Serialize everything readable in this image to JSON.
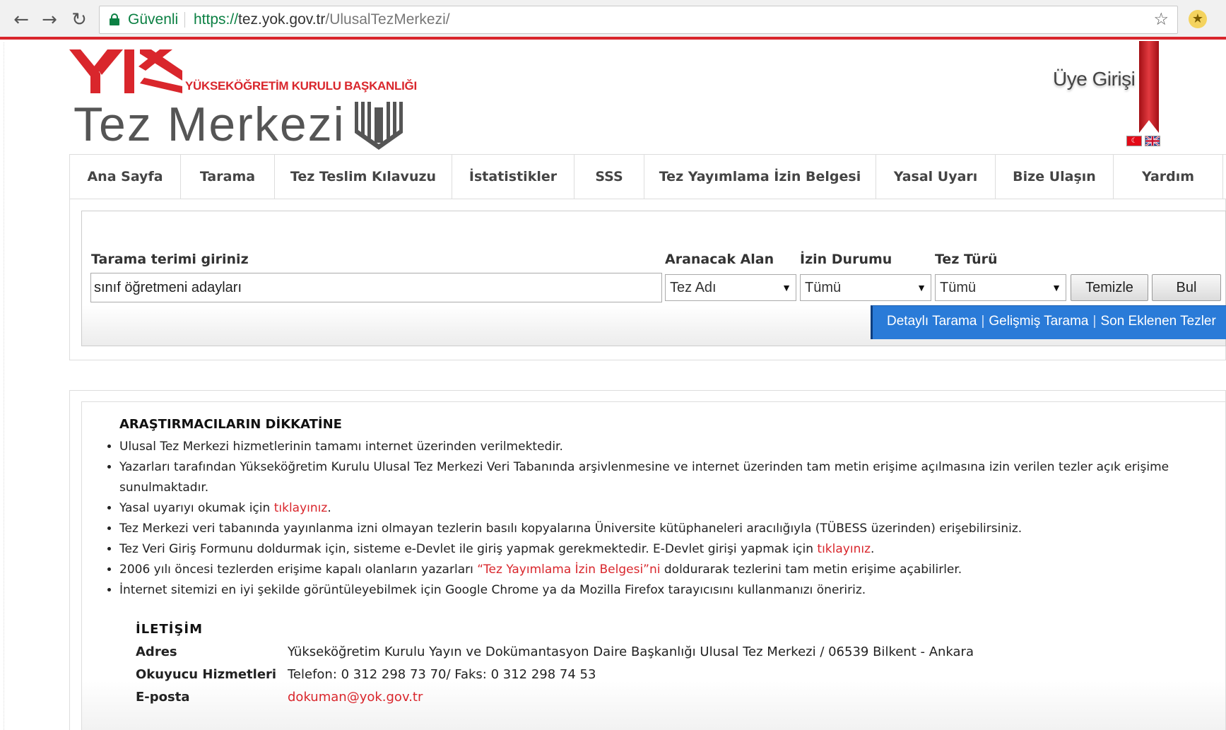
{
  "browser": {
    "secure_label": "Güvenli",
    "url_protocol": "https://",
    "url_host": "tez.yok.gov.tr",
    "url_path": "/UlusalTezMerkezi/"
  },
  "header": {
    "org_name": "YÜKSEKÖĞRETİM KURULU BAŞKANLIĞI",
    "site_title": "Tez Merkezi",
    "member_login": "Üye Girişi",
    "lang_tr": "☾"
  },
  "nav": [
    {
      "label": "Ana Sayfa"
    },
    {
      "label": "Tarama"
    },
    {
      "label": "Tez Teslim Kılavuzu"
    },
    {
      "label": "İstatistikler"
    },
    {
      "label": "SSS"
    },
    {
      "label": "Tez Yayımlama İzin Belgesi"
    },
    {
      "label": "Yasal Uyarı"
    },
    {
      "label": "Bize Ulaşın"
    },
    {
      "label": "Yardım"
    }
  ],
  "search": {
    "term_label": "Tarama terimi giriniz",
    "term_value": "sınıf öğretmeni adayları",
    "field_label": "Aranacak Alan",
    "field_value": "Tez Adı",
    "permission_label": "İzin Durumu",
    "permission_value": "Tümü",
    "type_label": "Tez Türü",
    "type_value": "Tümü",
    "clear_button": "Temizle",
    "find_button": "Bul",
    "links": {
      "detailed": "Detaylı Tarama",
      "advanced": "Gelişmiş Tarama",
      "latest": "Son Eklenen Tezler",
      "separator": "|"
    }
  },
  "notice": {
    "title": "ARAŞTIRMACILARIN DİKKATİNE",
    "items": [
      {
        "text": "Ulusal Tez Merkezi hizmetlerinin tamamı internet üzerinden verilmektedir."
      },
      {
        "text": "Yazarları tarafından Yükseköğretim Kurulu Ulusal Tez Merkezi Veri Tabanında arşivlenmesine ve internet üzerinden tam metin erişime açılmasına izin verilen tezler açık erişime sunulmaktadır."
      },
      {
        "text_before": "Yasal uyarıyı okumak için ",
        "link": "tıklayınız",
        "text_after": "."
      },
      {
        "text": "Tez Merkezi veri tabanında yayınlanma izni olmayan tezlerin basılı kopyalarına Üniversite kütüphaneleri aracılığıyla (TÜBESS üzerinden) erişebilirsiniz."
      },
      {
        "text_before": "Tez Veri Giriş Formunu doldurmak için, sisteme e-Devlet ile giriş yapmak gerekmektedir. E-Devlet girişi yapmak için ",
        "link": "tıklayınız",
        "text_after": "."
      },
      {
        "text_before": "2006 yılı öncesi tezlerden erişime kapalı olanların yazarları ",
        "link": "“Tez Yayımlama İzin Belgesi”ni",
        "text_after": " doldurarak tezlerini tam metin erişime açabilirler."
      },
      {
        "text": "İnternet sitemizi en iyi şekilde görüntüleyebilmek için Google Chrome ya da Mozilla Firefox tarayıcısını kullanmanızı öneririz."
      }
    ]
  },
  "contact": {
    "title": "İLETİŞİM",
    "address_label": "Adres",
    "address_value": "Yükseköğretim Kurulu Yayın ve Dokümantasyon Daire Başkanlığı Ulusal Tez Merkezi / 06539 Bilkent - Ankara",
    "reader_label": "Okuyucu Hizmetleri",
    "reader_value": "Telefon: 0 312 298 73 70/ Faks: 0 312 298 74 53",
    "email_label": "E-posta",
    "email_value": "dokuman@yok.gov.tr"
  },
  "colors": {
    "brand_red": "#d9262c",
    "link_blue": "#2a7bd8",
    "secure_green": "#0b8043"
  }
}
